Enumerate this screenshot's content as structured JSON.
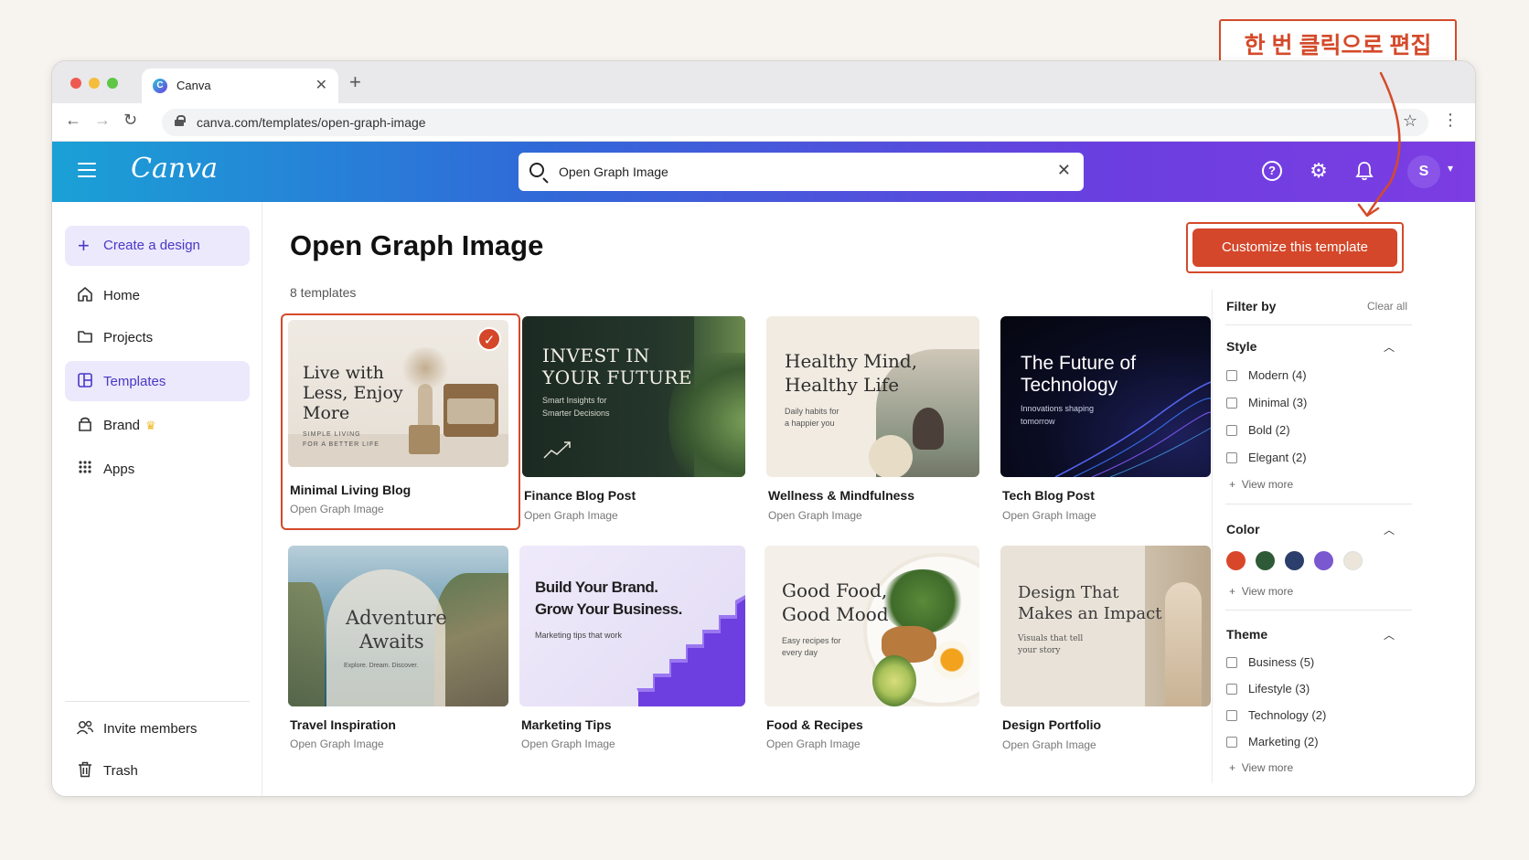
{
  "browser": {
    "tab_title": "Canva",
    "tab_favicon": "C",
    "url": "canva.com/templates/open-graph-image"
  },
  "header": {
    "logo": "Canva",
    "search_value": "Open Graph Image",
    "avatar_initial": "S",
    "gradient": [
      "#1aa1d6",
      "#6b3ee0"
    ]
  },
  "sidebar": {
    "create_label": "Create a design",
    "items": [
      {
        "label": "Home",
        "icon": "home-icon"
      },
      {
        "label": "Projects",
        "icon": "folder-icon"
      },
      {
        "label": "Templates",
        "icon": "templates-icon"
      },
      {
        "label": "Brand",
        "icon": "brand-icon"
      },
      {
        "label": "Apps",
        "icon": "apps-grid-icon"
      }
    ],
    "bottom_items": [
      {
        "label": "Invite members",
        "icon": "invite-members-icon"
      },
      {
        "label": "Trash",
        "icon": "trash-icon"
      }
    ]
  },
  "main": {
    "title": "Open Graph Image",
    "count": "8 templates",
    "customize_label": "Customize this template",
    "accent": "#d4472a"
  },
  "templates": [
    {
      "title": "Minimal Living Blog",
      "sub": "Open Graph Image",
      "selected": true,
      "thumb": {
        "line1": "Live with",
        "line2": "Less, Enjoy",
        "line3": "More",
        "small1": "SIMPLE LIVING",
        "small2": "FOR A BETTER LIFE"
      }
    },
    {
      "title": "Finance Blog Post",
      "sub": "Open Graph Image",
      "thumb": {
        "line1": "INVEST IN",
        "line2": "YOUR FUTURE",
        "small1": "Smart Insights for",
        "small2": "Smarter Decisions"
      }
    },
    {
      "title": "Wellness & Mindfulness",
      "sub": "Open Graph Image",
      "thumb": {
        "line1": "Healthy Mind,",
        "line2": "Healthy Life",
        "small1": "Daily habits for",
        "small2": "a happier you"
      }
    },
    {
      "title": "Tech Blog Post",
      "sub": "Open Graph Image",
      "thumb": {
        "line1": "The Future of",
        "line2": "Technology",
        "small1": "Innovations shaping",
        "small2": "tomorrow"
      }
    },
    {
      "title": "Travel Inspiration",
      "sub": "Open Graph Image",
      "thumb": {
        "line1": "Adventure",
        "line2": "Awaits",
        "small1": "Explore. Dream. Discover."
      }
    },
    {
      "title": "Marketing Tips",
      "sub": "Open Graph Image",
      "thumb": {
        "line1": "Build Your Brand.",
        "line2": "Grow Your Business.",
        "small1": "Marketing tips that work"
      }
    },
    {
      "title": "Food & Recipes",
      "sub": "Open Graph Image",
      "thumb": {
        "line1": "Good Food,",
        "line2": "Good Mood",
        "small1": "Easy recipes for",
        "small2": "every day"
      }
    },
    {
      "title": "Design Portfolio",
      "sub": "Open Graph Image",
      "thumb": {
        "line1": "Design That",
        "line2": "Makes an Impact",
        "small1": "Visuals that tell",
        "small2": "your story"
      }
    }
  ],
  "filters": {
    "heading": "Filter by",
    "clear": "Clear all",
    "view_more": "View more",
    "style": {
      "label": "Style",
      "options": [
        "Modern (4)",
        "Minimal (3)",
        "Bold (2)",
        "Elegant (2)"
      ]
    },
    "color": {
      "label": "Color",
      "swatches": [
        "#d9472b",
        "#2f5a37",
        "#2c3e6b",
        "#7a58cf",
        "#ece6da"
      ]
    },
    "theme": {
      "label": "Theme",
      "options": [
        "Business (5)",
        "Lifestyle (3)",
        "Technology (2)",
        "Marketing (2)"
      ]
    }
  },
  "annotation": {
    "text": "한 번 클릭으로 편집",
    "color": "#d44a2a"
  }
}
